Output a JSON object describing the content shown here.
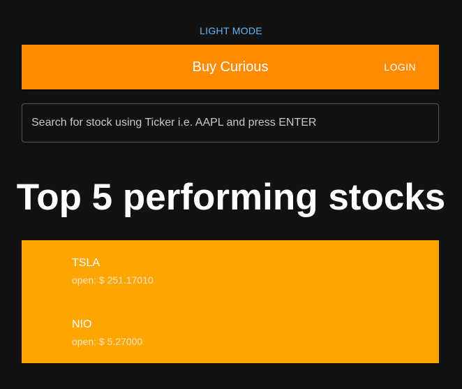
{
  "mode_toggle": {
    "label": "LIGHT MODE"
  },
  "appbar": {
    "title": "Buy Curious",
    "login_label": "LOGIN"
  },
  "search": {
    "placeholder": "Search for stock using Ticker i.e. AAPL and press ENTER",
    "value": ""
  },
  "main": {
    "heading": "Top 5 performing stocks",
    "stocks": [
      {
        "symbol": "TSLA",
        "open": "open: $ 251.17010"
      },
      {
        "symbol": "NIO",
        "open": "open: $ 5.27000"
      }
    ]
  },
  "colors": {
    "background": "#121212",
    "appbar": "#ff8c00",
    "list": "#ffa500",
    "link": "#64b5f6"
  }
}
